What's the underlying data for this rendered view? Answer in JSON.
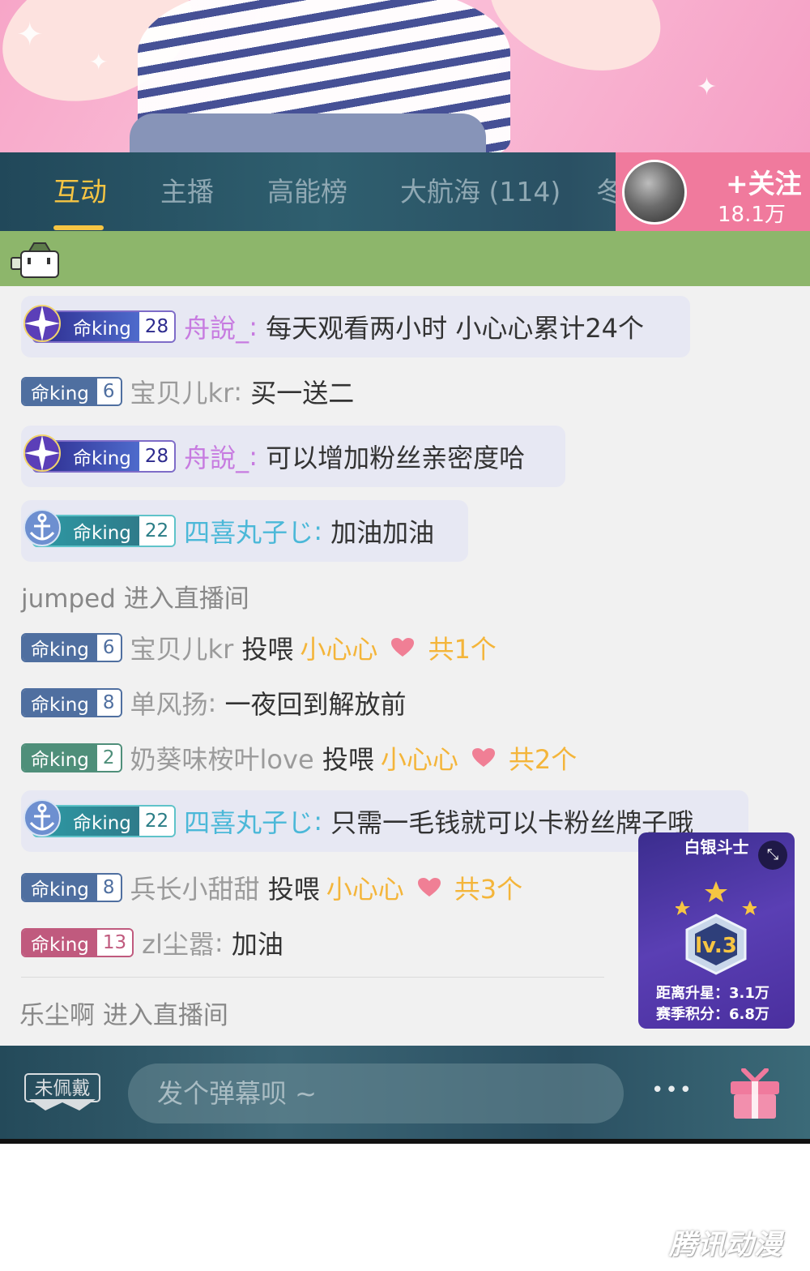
{
  "tabs": [
    {
      "label": "互动",
      "active": true
    },
    {
      "label": "主播",
      "active": false
    },
    {
      "label": "高能榜",
      "active": false
    },
    {
      "label": "大航海 (114)",
      "active": false
    },
    {
      "label": "冬",
      "active": false
    }
  ],
  "follow": {
    "label": "+关注",
    "count": "18.1万"
  },
  "medal_name": "命king",
  "messages": [
    {
      "level": "28",
      "user": "舟說_",
      "sep": ":",
      "text": "每天观看两小时 小心心累计24个"
    },
    {
      "level": "6",
      "user": "宝贝儿kr",
      "sep": ":",
      "text": "买一送二"
    },
    {
      "level": "28",
      "user": "舟說_",
      "sep": ":",
      "text": "可以增加粉丝亲密度哈"
    },
    {
      "level": "22",
      "user": "四喜丸子じ",
      "sep": ":",
      "text": "加油加油"
    },
    {
      "system": "jumped 进入直播间"
    },
    {
      "level": "6",
      "user": "宝贝儿kr",
      "action": "投喂",
      "gift": "小心心",
      "count": "共1个"
    },
    {
      "level": "8",
      "user": "单风扬",
      "sep": ":",
      "text": "一夜回到解放前"
    },
    {
      "level": "2",
      "user": "奶葵味桉叶love",
      "action": "投喂",
      "gift": "小心心",
      "count": "共2个"
    },
    {
      "level": "22",
      "user": "四喜丸子じ",
      "sep": ":",
      "text": "只需一毛钱就可以卡粉丝牌子哦"
    },
    {
      "level": "8",
      "user": "兵长小甜甜",
      "action": "投喂",
      "gift": "小心心",
      "count": "共3个"
    },
    {
      "level": "13",
      "user": "zl尘嚣",
      "sep": ":",
      "text": "加油"
    },
    {
      "system": "乐尘啊 进入直播间"
    }
  ],
  "level_card": {
    "title": "白银斗士",
    "badge": "lv.3",
    "stars": 3,
    "stat1": "距离升星：3.1万",
    "stat2": "赛季积分：6.8万"
  },
  "bottom": {
    "medal_slot": "未佩戴",
    "placeholder": "发个弹幕呗 ~",
    "more": "•••"
  },
  "watermark": "腾讯动漫",
  "colors": {
    "accent": "#f6c543",
    "follow_bg": "#f07a9d",
    "strip_green": "#8db66b",
    "medal_blue": "#4f6fa0",
    "medal_green": "#4f8f7a",
    "medal_pink": "#c05a7e"
  }
}
